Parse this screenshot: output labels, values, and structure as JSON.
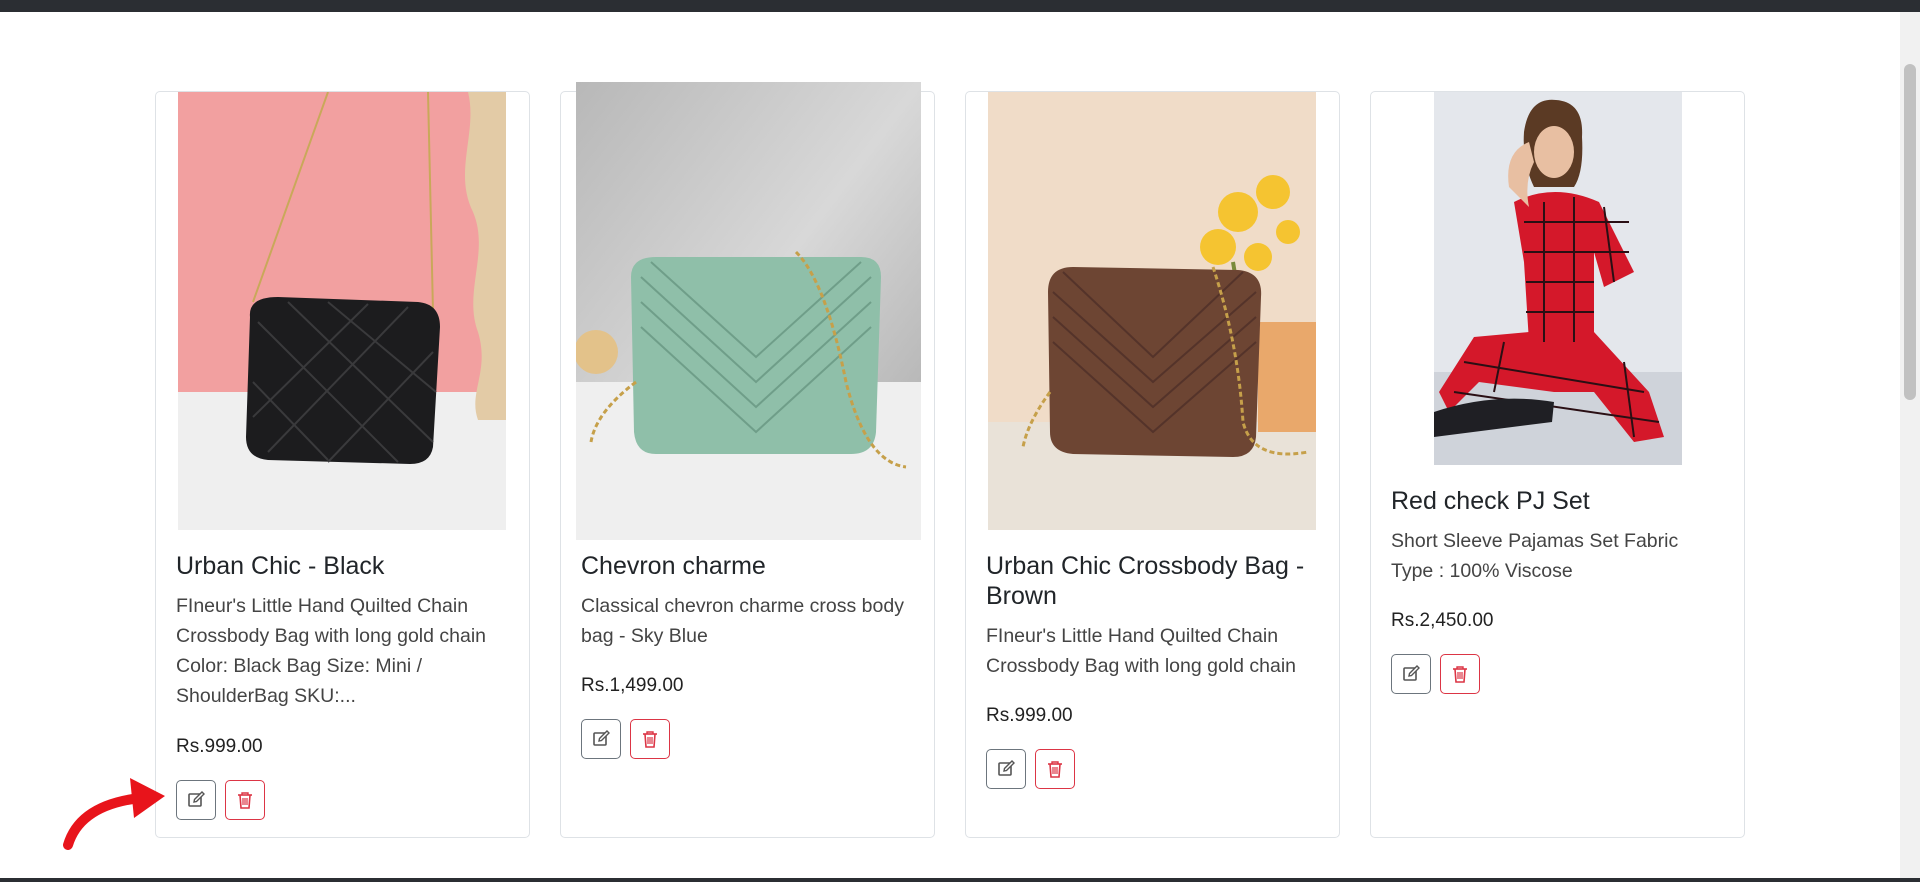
{
  "products": [
    {
      "title": "Urban Chic - Black",
      "description": "FIneur's Little Hand Quilted Chain Crossbody Bag with long gold chain Color: Black Bag Size: Mini / ShoulderBag SKU:...",
      "price": "Rs.999.00",
      "image_alt": "Black quilted crossbody bag"
    },
    {
      "title": "Chevron charme",
      "description": "Classical chevron charme cross body bag - Sky Blue",
      "price": "Rs.1,499.00",
      "image_alt": "Sky blue chevron crossbody bag"
    },
    {
      "title": "Urban Chic Crossbody Bag - Brown",
      "description": "FIneur's Little Hand Quilted Chain Crossbody Bag with long gold chain",
      "price": "Rs.999.00",
      "image_alt": "Brown chevron crossbody bag"
    },
    {
      "title": "Red check PJ Set",
      "description": "Short Sleeve Pajamas Set Fabric Type : 100% Viscose",
      "price": "Rs.2,450.00",
      "image_alt": "Red check pajama set"
    }
  ],
  "icons": {
    "edit": "edit-icon",
    "delete": "trash-icon",
    "annotation": "red-arrow"
  },
  "colors": {
    "edit_border": "#6c757d",
    "delete_red": "#dc3545",
    "arrow_red": "#e8141b"
  }
}
